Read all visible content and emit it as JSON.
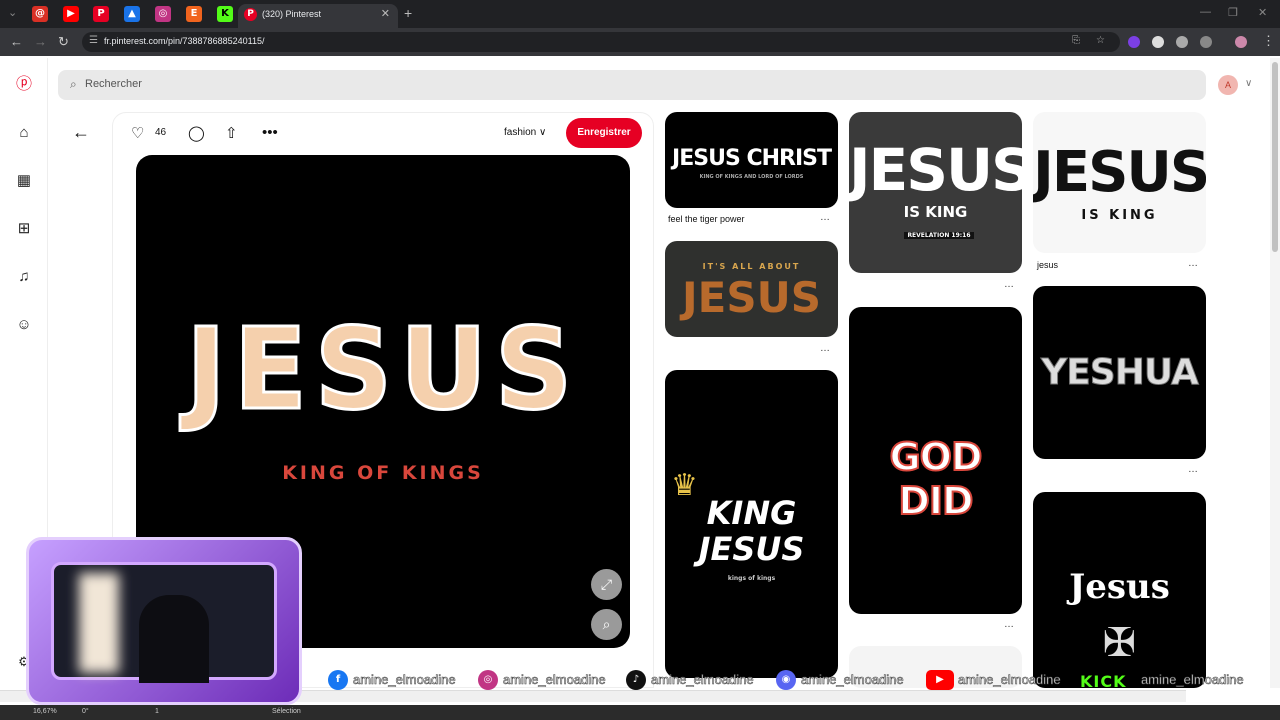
{
  "browser": {
    "active_tab_title": "(320) Pinterest",
    "url": "fr.pinterest.com/pin/738878688524011​5/",
    "tab_favicons": [
      {
        "name": "threads",
        "glyph": "@",
        "color": "#d93025"
      },
      {
        "name": "youtube",
        "glyph": "▶",
        "color": "#ff0000"
      },
      {
        "name": "pinterest",
        "glyph": "P",
        "color": "#e60023"
      },
      {
        "name": "app",
        "glyph": "▲",
        "color": "#1a73e8"
      },
      {
        "name": "instagram",
        "glyph": "◎",
        "color": "#c13584"
      },
      {
        "name": "etsy",
        "glyph": "E",
        "color": "#f1641e"
      },
      {
        "name": "kick",
        "glyph": "K",
        "color": "#53fc18"
      }
    ]
  },
  "search": {
    "placeholder": "Rechercher"
  },
  "profile": {
    "initial": "A"
  },
  "pin": {
    "likes": "46",
    "board": "fashion",
    "board_chevron": "∨",
    "save_label": "Enregistrer",
    "image_title": "JESUS",
    "image_subtitle": "KING OF KINGS"
  },
  "feed": [
    {
      "title": "JESUS CHRIST",
      "sub": "KING OF KINGS AND LORD OF LORDS",
      "caption": "feel the tiger power"
    },
    {
      "title": "JESUS",
      "sub": "IT'S ALL ABOUT",
      "caption": ""
    },
    {
      "title": "KING JESUS",
      "sub": "kings of kings",
      "caption": ""
    },
    {
      "title": "JESUS",
      "sub": "IS KING",
      "tag": "REVELATION 19:16",
      "caption": ""
    },
    {
      "title": "GOD DID",
      "caption": ""
    },
    {
      "title": "JESUS",
      "sub": "IS KING",
      "caption": "jesus"
    },
    {
      "title": "YESHUA",
      "caption": ""
    },
    {
      "title": "Jesus",
      "caption": ""
    }
  ],
  "more_glyph": "…",
  "social": {
    "handle_1": "amine_elmoadine",
    "handle_2": "amine_elmoadine",
    "handle_3": "amine_elmoadine",
    "handle_4": "amine_elmoadine",
    "handle_5": "amine_elmoadine",
    "kick": "KICK",
    "handle_6": "amine_elmoadine"
  },
  "taskbar": {
    "zoom": "16,67%",
    "value": "0°",
    "page": "1",
    "mode": "Sélection"
  }
}
